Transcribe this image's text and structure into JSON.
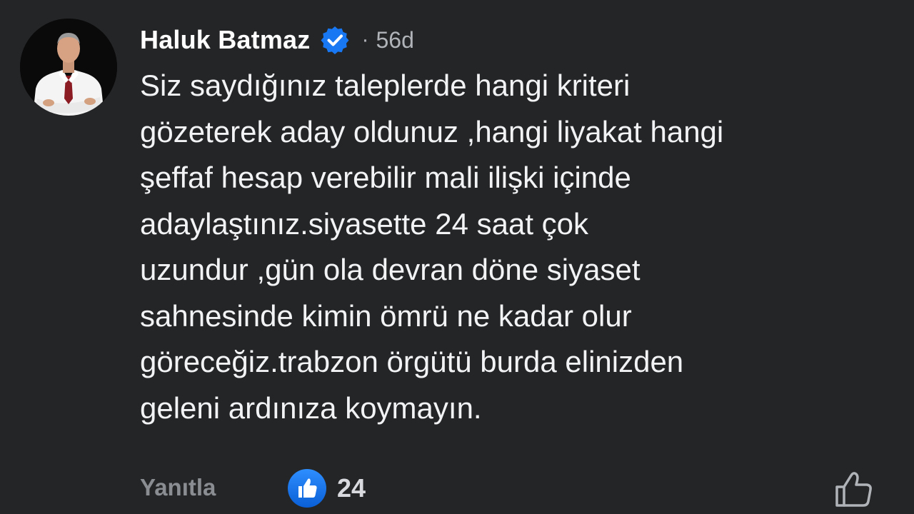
{
  "comment": {
    "author": "Haluk Batmaz",
    "separator": "·",
    "time": "56d",
    "lines": [
      "Siz saydığınız taleplerde hangi kriteri",
      "gözeterek aday oldunuz ,hangi liyakat hangi",
      "şeffaf hesap verebilir mali ilişki içinde",
      "adaylaştınız.siyasette 24 saat çok",
      "uzundur ,gün ola devran döne siyaset",
      "sahnesinde kimin ömrü ne kadar olur",
      "göreceğiz.trabzon örgütü burda elinizden",
      "geleni ardınıza koymayın."
    ]
  },
  "actions": {
    "reply_label": "Yanıtla",
    "like_count": "24"
  },
  "icons": {
    "verified": "verified-badge-icon",
    "reaction": "like-reaction-icon",
    "like_button": "thumbs-up-outline-icon"
  },
  "colors": {
    "background": "#242526",
    "text": "#f2f3f5",
    "secondary_text": "#b0b3b8",
    "accent_blue": "#1877f2"
  }
}
